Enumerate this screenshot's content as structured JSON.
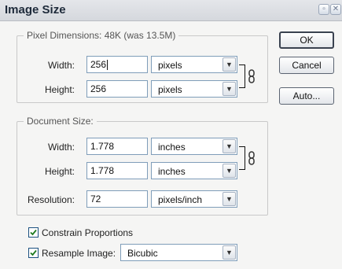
{
  "window": {
    "title": "Image Size"
  },
  "pixel_dimensions": {
    "legend": "Pixel Dimensions:  48K (was 13.5M)",
    "width": {
      "label": "Width:",
      "value": "256",
      "unit": "pixels"
    },
    "height": {
      "label": "Height:",
      "value": "256",
      "unit": "pixels"
    }
  },
  "document_size": {
    "legend": "Document Size:",
    "width": {
      "label": "Width:",
      "value": "1.778",
      "unit": "inches"
    },
    "height": {
      "label": "Height:",
      "value": "1.778",
      "unit": "inches"
    },
    "resolution": {
      "label": "Resolution:",
      "value": "72",
      "unit": "pixels/inch"
    }
  },
  "buttons": {
    "ok": "OK",
    "cancel": "Cancel",
    "auto": "Auto..."
  },
  "options": {
    "constrain_proportions": {
      "label": "Constrain Proportions",
      "checked": true
    },
    "resample_image": {
      "label": "Resample Image:",
      "checked": true,
      "method": "Bicubic"
    }
  },
  "icons": {
    "minimize": "minimize-icon",
    "close": "close-icon",
    "dropdown": "chevron-down-icon",
    "link": "chain-link-icon",
    "check": "checkmark-icon"
  }
}
